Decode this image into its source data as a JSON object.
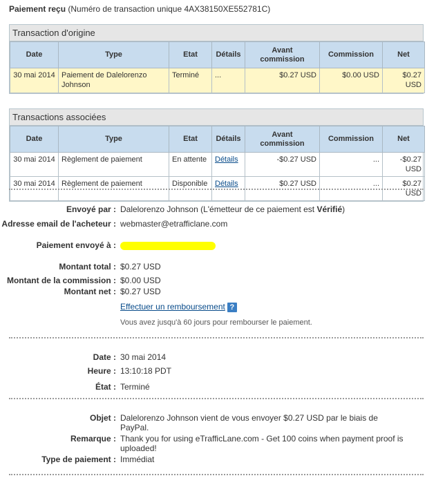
{
  "header": {
    "title": "Paiement reçu",
    "subtitle": "(Numéro de transaction unique 4AX38150XE552781C)"
  },
  "origin": {
    "title": "Transaction d'origine",
    "columns": [
      "Date",
      "Type",
      "Etat",
      "Détails",
      "Avant commission",
      "Commission",
      "Net"
    ],
    "row": {
      "date": "30 mai 2014",
      "type": "Paiement de Dalelorenzo Johnson",
      "etat": "Terminé",
      "details": "...",
      "avant": "$0.27 USD",
      "commission": "$0.00 USD",
      "net": "$0.27 USD"
    }
  },
  "related": {
    "title": "Transactions associées",
    "columns": [
      "Date",
      "Type",
      "Etat",
      "Détails",
      "Avant commission",
      "Commission",
      "Net"
    ],
    "rows": [
      {
        "date": "30 mai 2014",
        "type": "Règlement de paiement",
        "etat": "En attente",
        "details": "Détails",
        "avant": "-$0.27 USD",
        "commission": "...",
        "net": "-$0.27 USD"
      },
      {
        "date": "30 mai 2014",
        "type": "Règlement de paiement",
        "etat": "Disponible",
        "details": "Détails",
        "avant": "$0.27 USD",
        "commission": "...",
        "net": "$0.27 USD"
      }
    ]
  },
  "sender": {
    "sent_by_label": "Envoyé par :",
    "sent_by_value": "Dalelorenzo Johnson (L'émetteur de ce paiement est ",
    "verified": "Vérifié",
    "verified_close": ")",
    "email_label": "Adresse email de l'acheteur :",
    "email_value": "webmaster@etrafficlane.com",
    "sent_to_label": "Paiement envoyé à :"
  },
  "amounts": {
    "total_label": "Montant total :",
    "total_value": "$0.27 USD",
    "fee_label": "Montant de la commission :",
    "fee_value": "$0.00 USD",
    "net_label": "Montant net :",
    "net_value": "$0.27 USD",
    "refund_link": "Effectuer un remboursement",
    "help_icon": "?",
    "refund_note": "Vous avez jusqu'à 60 jours pour rembourser le paiement."
  },
  "timing": {
    "date_label": "Date :",
    "date_value": "30 mai 2014",
    "time_label": "Heure :",
    "time_value": "13:10:18 PDT",
    "state_label": "État :",
    "state_value": "Terminé"
  },
  "message": {
    "subject_label": "Objet :",
    "subject_value": "Dalelorenzo Johnson vient de vous envoyer $0.27 USD par le biais de PayPal.",
    "note_label": "Remarque :",
    "note_value": "Thank you for using eTrafficLane.com - Get 100 coins when payment proof is uploaded!",
    "type_label": "Type de paiement :",
    "type_value": "Immédiat"
  },
  "colors": {
    "header_bg": "#c8dcee",
    "highlight_row": "#fff7c8",
    "link": "#084b8a",
    "redaction": "#ffff00"
  }
}
